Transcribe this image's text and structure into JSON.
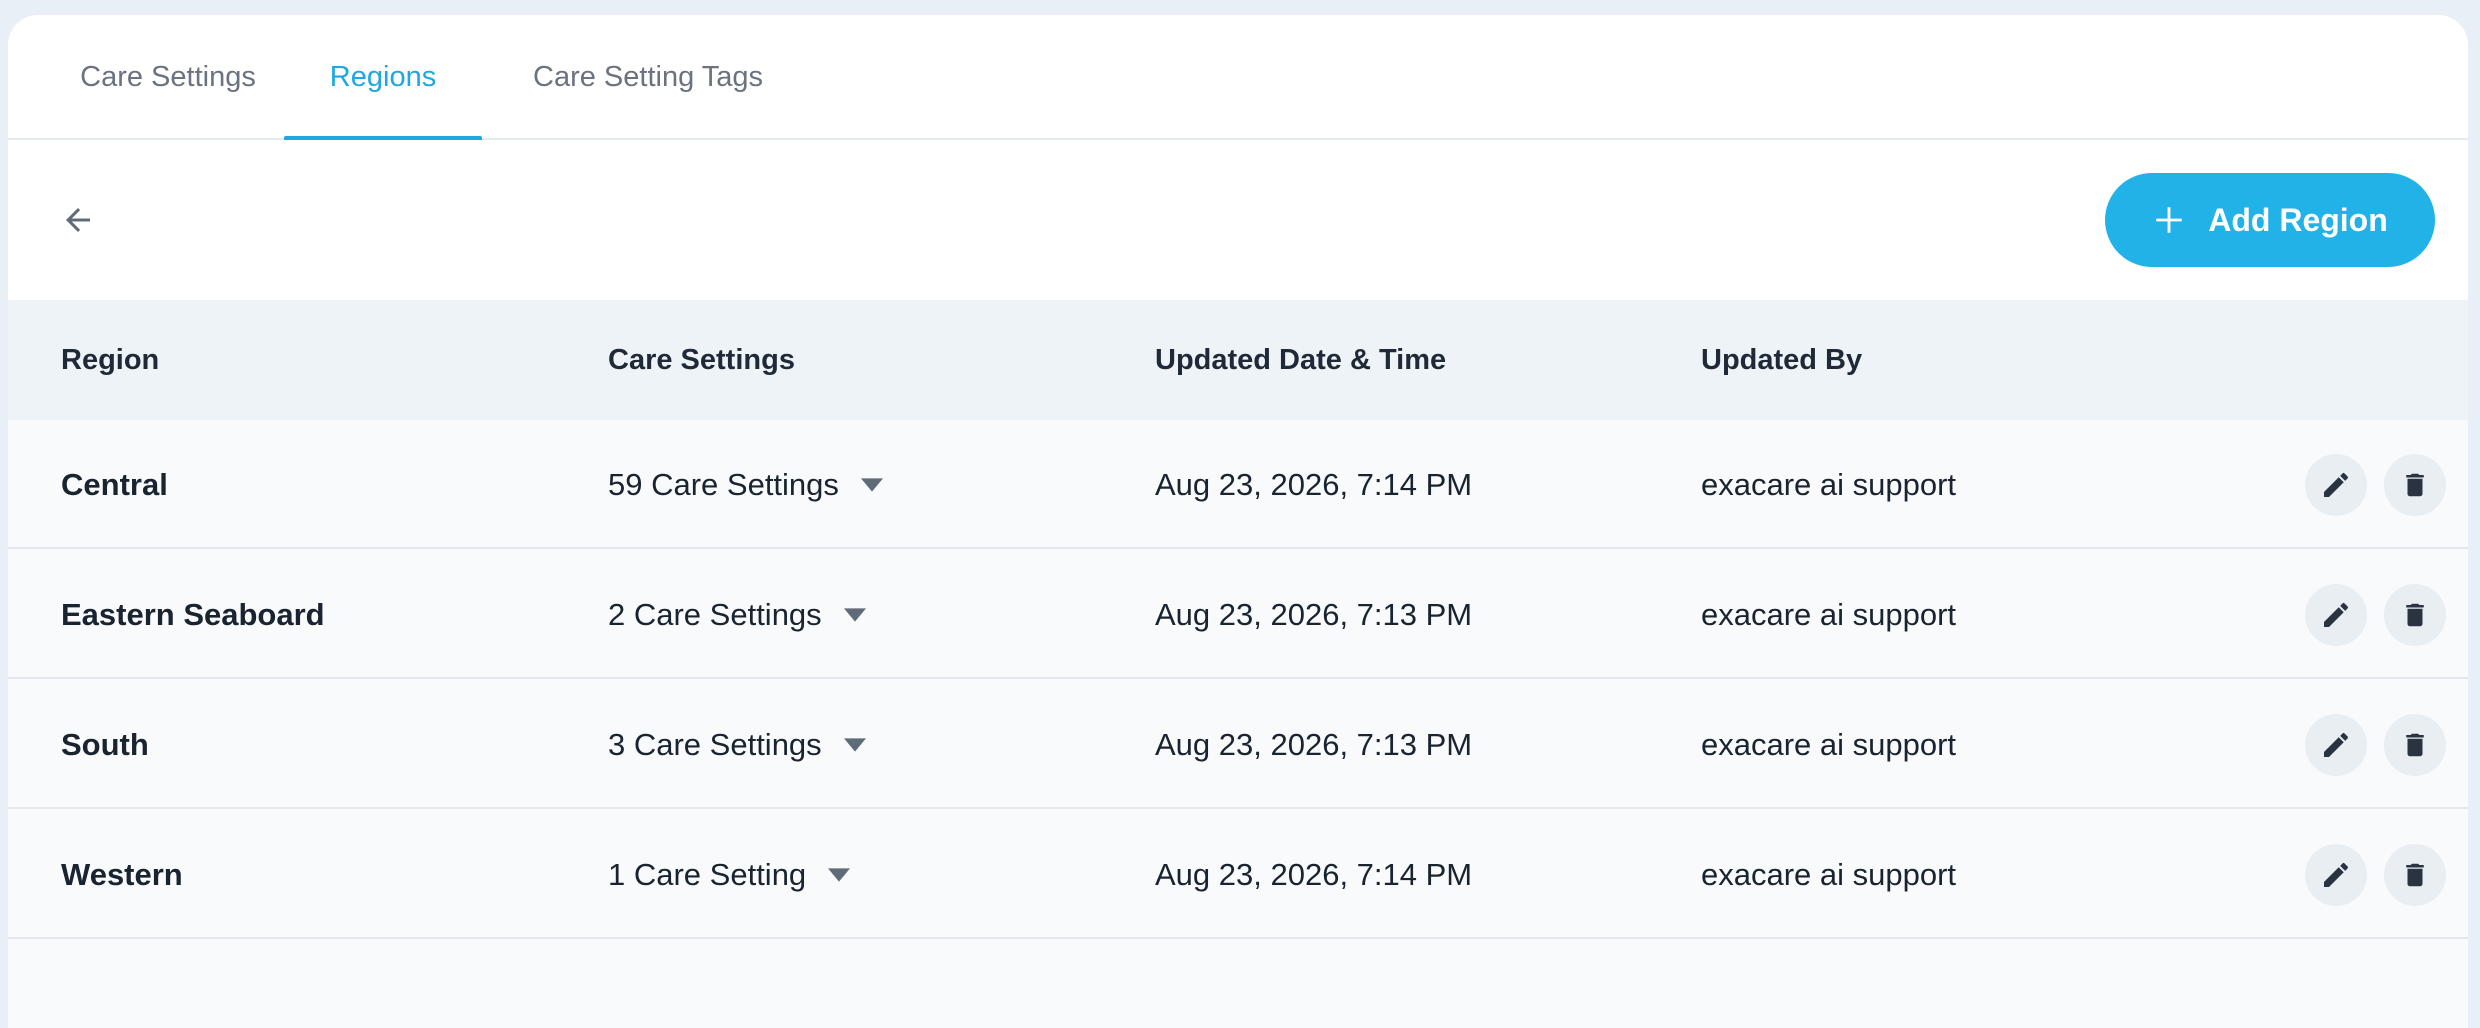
{
  "tabs": [
    {
      "label": "Care Settings",
      "active": false
    },
    {
      "label": "Regions",
      "active": true
    },
    {
      "label": "Care Setting Tags",
      "active": false
    }
  ],
  "toolbar": {
    "back_icon": "arrow-left-icon",
    "add_button_label": "Add Region",
    "add_button_icon": "plus-icon"
  },
  "table": {
    "headers": [
      "Region",
      "Care Settings",
      "Updated Date & Time",
      "Updated By"
    ],
    "rows": [
      {
        "region": "Central",
        "care_settings": "59 Care Settings",
        "updated_at": "Aug 23, 2026, 7:14 PM",
        "updated_by": "exacare ai support"
      },
      {
        "region": "Eastern Seaboard",
        "care_settings": "2 Care Settings",
        "updated_at": "Aug 23, 2026, 7:13 PM",
        "updated_by": "exacare ai support"
      },
      {
        "region": "South",
        "care_settings": "3 Care Settings",
        "updated_at": "Aug 23, 2026, 7:13 PM",
        "updated_by": "exacare ai support"
      },
      {
        "region": "Western",
        "care_settings": "1 Care Setting",
        "updated_at": "Aug 23, 2026, 7:14 PM",
        "updated_by": "exacare ai support"
      }
    ],
    "row_actions": [
      "pencil-icon",
      "trash-icon"
    ]
  },
  "colors": {
    "accent": "#1ea7e4",
    "button": "#21b2e8",
    "header_bg": "#eef3f7",
    "page_bg": "#e8eff6"
  }
}
